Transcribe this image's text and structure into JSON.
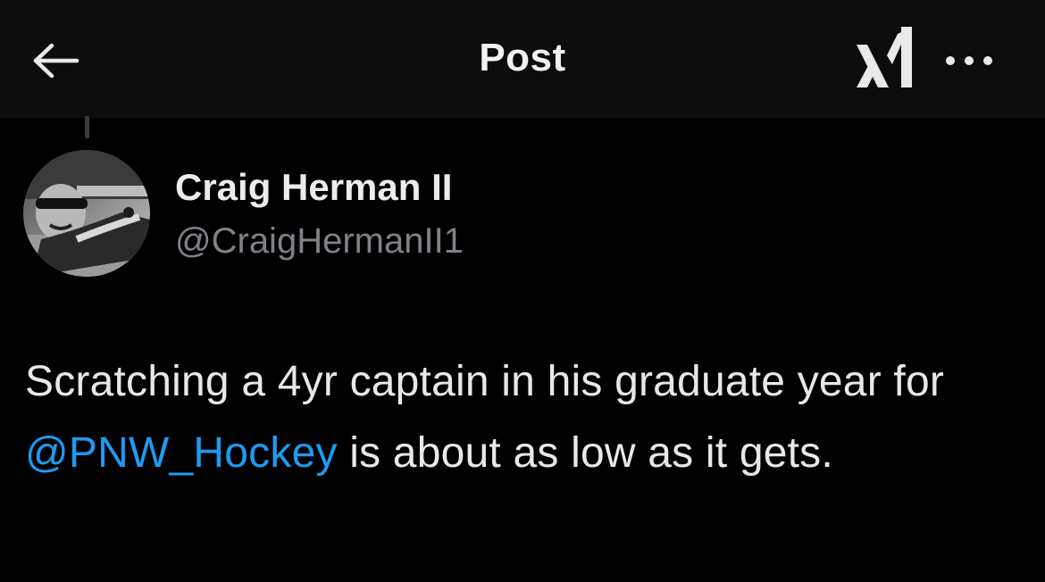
{
  "header": {
    "title": "Post",
    "back_icon": "arrow-left-icon",
    "logo_icon": "xai-logo-icon",
    "more_icon": "more-horizontal-icon"
  },
  "post": {
    "author": {
      "display_name": "Craig Herman II",
      "handle": "@CraigHermanII1",
      "avatar": "profile-photo"
    },
    "text_before_mention": "Scratching a 4yr captain in his graduate year for ",
    "mention": "@PNW_Hockey",
    "text_after_mention": " is about as low as it gets."
  },
  "colors": {
    "background": "#000000",
    "header_background": "#0d0d0d",
    "text": "#e8e8e8",
    "secondary_text": "#7e8288",
    "link": "#1d9bf0"
  }
}
